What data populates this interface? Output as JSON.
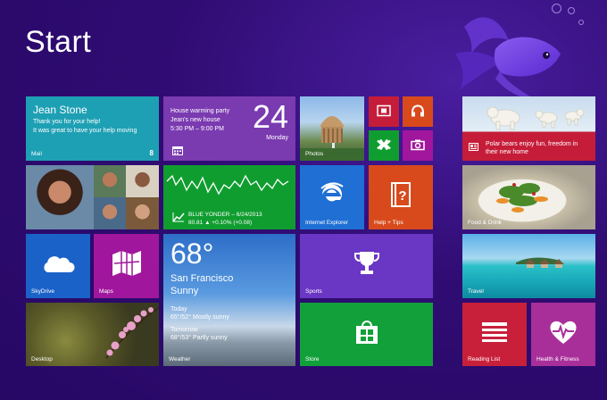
{
  "screen": {
    "title": "Start"
  },
  "tiles": {
    "mail": {
      "name": "Jean Stone",
      "line1": "Thank you for your help!",
      "line2": "It was great to have your help moving",
      "label": "Mail",
      "badge": "8"
    },
    "calendar": {
      "event": "House warming party",
      "location": "Jean's new house",
      "time": "5:30 PM – 9:00 PM",
      "day": "24",
      "weekday": "Monday"
    },
    "photos": {
      "label": "Photos"
    },
    "finance": {
      "ticker": "BLUE YONDER – 6/24/2013",
      "quote": "80.81 ▲ +0.10% (+0.08)"
    },
    "ie": {
      "label": "Internet Explorer"
    },
    "help": {
      "label": "Help + Tips"
    },
    "skydrive": {
      "label": "SkyDrive"
    },
    "maps": {
      "label": "Maps"
    },
    "weather": {
      "temp": "68°",
      "city": "San Francisco",
      "condition": "Sunny",
      "today_label": "Today",
      "today_forecast": "65°/52° Mostly sunny",
      "tomorrow_label": "Tomorrow",
      "tomorrow_forecast": "68°/53° Partly sunny",
      "label": "Weather"
    },
    "sports": {
      "label": "Sports"
    },
    "desktop": {
      "label": "Desktop"
    },
    "store": {
      "label": "Store"
    },
    "news": {
      "headline": "Polar bears enjoy fun, freedom in their new home"
    },
    "food": {
      "label": "Food & Drink"
    },
    "travel": {
      "label": "Travel"
    },
    "reading": {
      "label": "Reading List"
    },
    "health": {
      "label": "Health & Fitness"
    }
  },
  "colors": {
    "background": "#2d0a6b",
    "mail": "#1ea0b4",
    "calendar": "#7a3ab0",
    "finance": "#109d30",
    "ie": "#1f6fd4",
    "help": "#d84a1c",
    "skydrive": "#1a62c8",
    "maps": "#a0169c",
    "sports": "#6a36c4",
    "store": "#12a03a",
    "reading": "#c8203a",
    "health": "#a82f9a",
    "small_red": "#c51d39"
  },
  "icons": [
    "video-icon",
    "music-icon",
    "games-icon",
    "camera-icon",
    "calendar-icon",
    "chart-up-icon",
    "ie-icon",
    "help-icon",
    "cloud-icon",
    "map-icon",
    "trophy-icon",
    "store-icon",
    "news-icon",
    "reading-list-icon",
    "heart-icon"
  ]
}
